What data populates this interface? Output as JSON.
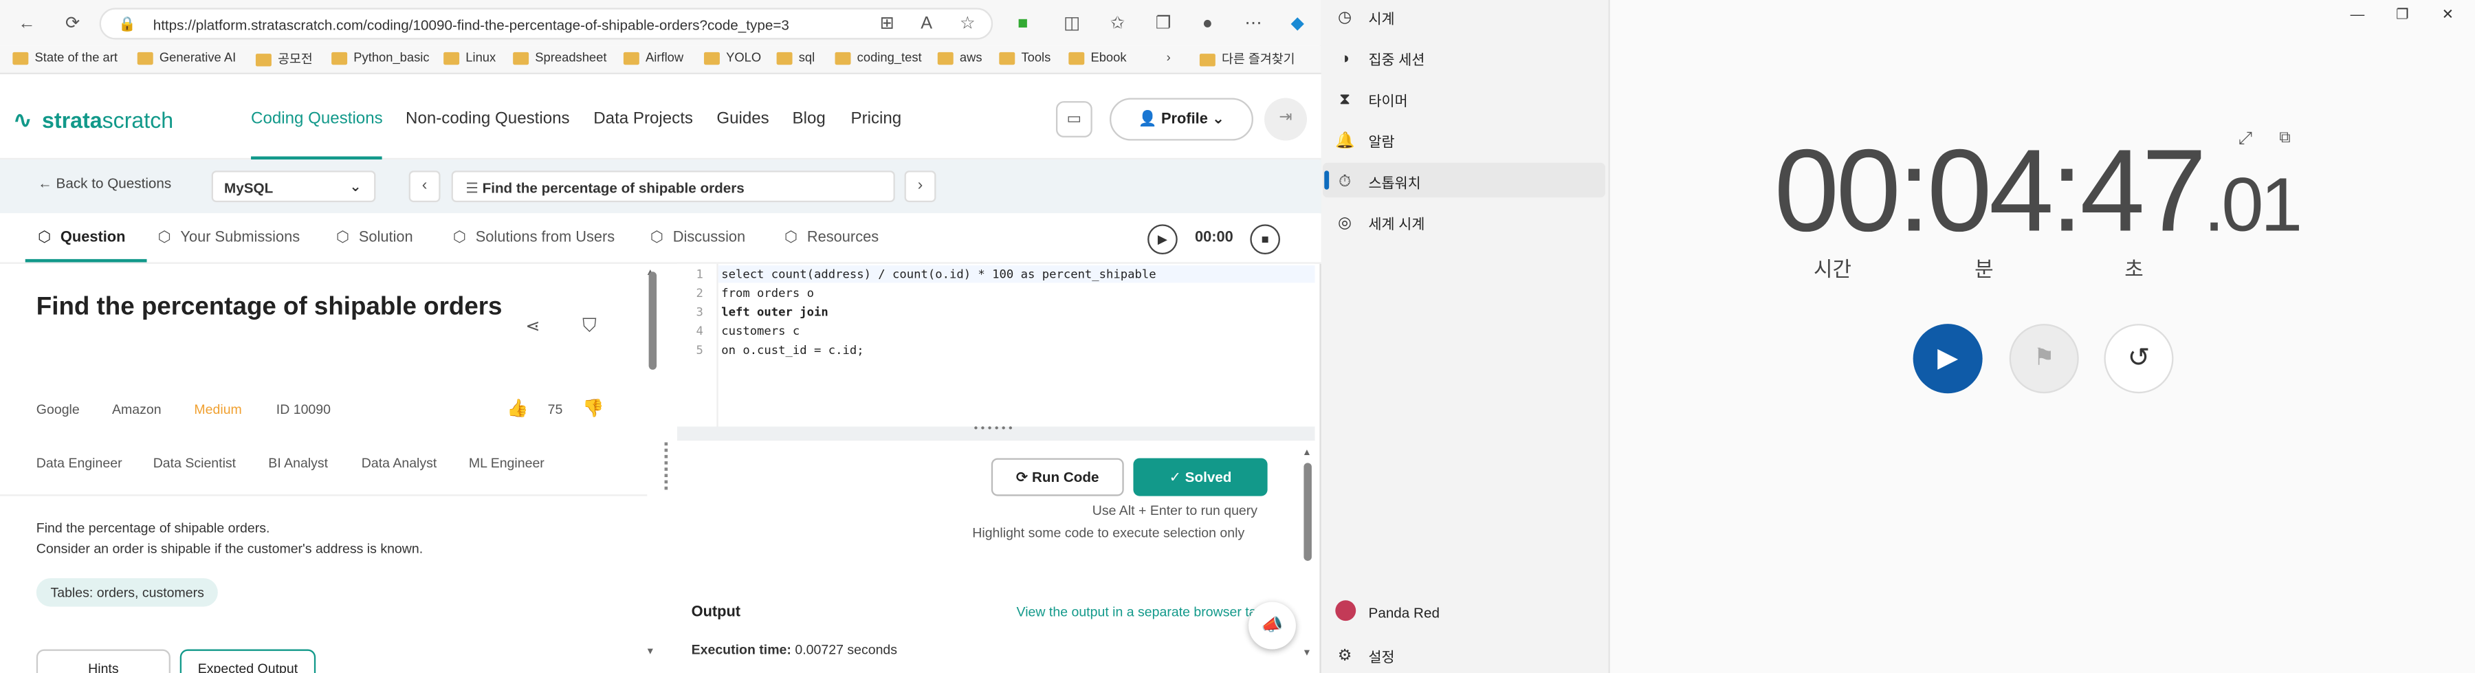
{
  "browser": {
    "url": "https://platform.stratascratch.com/coding/10090-find-the-percentage-of-shipable-orders?code_type=3",
    "bookmarks": [
      "State of the art",
      "Generative AI",
      "공모전",
      "Python_basic",
      "Linux",
      "Spreadsheet",
      "Airflow",
      "YOLO",
      "sql",
      "coding_test",
      "aws",
      "Tools",
      "Ebook",
      "다른 즐겨찾기"
    ]
  },
  "site": {
    "logo_bold": "strata",
    "logo_light": "scratch",
    "nav": [
      "Coding Questions",
      "Non-coding Questions",
      "Data Projects",
      "Guides",
      "Blog",
      "Pricing"
    ],
    "profile_label": "Profile",
    "back_label": "Back to Questions",
    "language": "MySQL",
    "question_select": "Find the percentage of shipable orders",
    "tabs": [
      "Question",
      "Your Submissions",
      "Solution",
      "Solutions from Users",
      "Discussion",
      "Resources"
    ],
    "timer": "00:00"
  },
  "question": {
    "title": "Find the percentage of shipable orders",
    "companies": [
      "Google",
      "Amazon"
    ],
    "difficulty": "Medium",
    "id": "ID 10090",
    "likes": "75",
    "roles": [
      "Data Engineer",
      "Data Scientist",
      "BI Analyst",
      "Data Analyst",
      "ML Engineer"
    ],
    "description": [
      "Find the percentage of shipable orders.",
      "Consider an order is shipable if the customer's address is known."
    ],
    "tables": "Tables: orders, customers",
    "hints_label": "Hints",
    "expected_label": "Expected Output"
  },
  "editor": {
    "lines": [
      "select count(address) / count(o.id) * 100 as percent_shipable",
      "from orders o",
      "left outer join",
      "customers c",
      "on o.cust_id = c.id;"
    ]
  },
  "results": {
    "run_label": "Run Code",
    "solved_label": "Solved",
    "hint1": "Use Alt + Enter to run query",
    "hint2": "Highlight some code to execute selection only",
    "output_label": "Output",
    "output_link": "View the output in a separate browser tab",
    "exec_label": "Execution time:",
    "exec_value": "0.00727 seconds"
  },
  "clock": {
    "sidebar": [
      "시계",
      "집중 세션",
      "타이머",
      "알람",
      "스톱워치",
      "세계 시계"
    ],
    "selected": "스톱워치",
    "user": "Panda Red",
    "settings": "설정",
    "time_main": "00:04:47",
    "time_cs": ".01",
    "units": [
      "시간",
      "분",
      "초"
    ]
  },
  "colors": {
    "accent": "#12998a",
    "clock_accent": "#0f5ba8",
    "difficulty": "#f0a030"
  }
}
